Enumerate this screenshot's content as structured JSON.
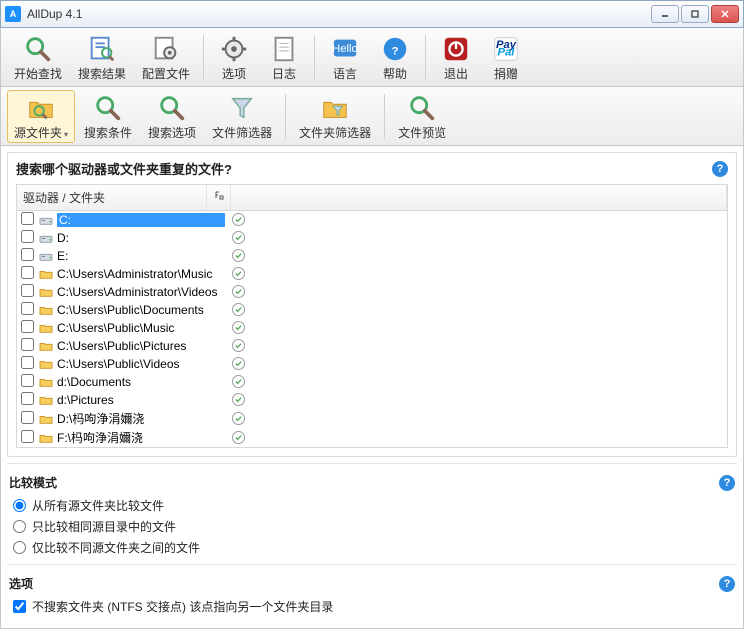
{
  "window": {
    "title": "AllDup 4.1"
  },
  "main_toolbar": [
    {
      "id": "start-search",
      "label": "开始查找",
      "icon": "magnifier"
    },
    {
      "id": "search-result",
      "label": "搜索结果",
      "icon": "result"
    },
    {
      "id": "config-file",
      "label": "配置文件",
      "icon": "gear-page"
    },
    {
      "sep": true
    },
    {
      "id": "options",
      "label": "选项",
      "icon": "gear"
    },
    {
      "id": "log",
      "label": "日志",
      "icon": "page"
    },
    {
      "sep": true
    },
    {
      "id": "language",
      "label": "语言",
      "icon": "hello"
    },
    {
      "id": "help",
      "label": "帮助",
      "icon": "help"
    },
    {
      "sep": true
    },
    {
      "id": "exit",
      "label": "退出",
      "icon": "power"
    },
    {
      "id": "donate",
      "label": "捐赠",
      "icon": "paypal"
    }
  ],
  "tab_toolbar": [
    {
      "id": "source-folders",
      "label": "源文件夹",
      "icon": "folder-search",
      "active": true,
      "dropdown": true
    },
    {
      "id": "search-criteria",
      "label": "搜索条件",
      "icon": "magnifier"
    },
    {
      "id": "search-options",
      "label": "搜索选项",
      "icon": "magnifier"
    },
    {
      "id": "file-filter",
      "label": "文件筛选器",
      "icon": "funnel"
    },
    {
      "sep": true
    },
    {
      "id": "folder-filter",
      "label": "文件夹筛选器",
      "icon": "folder-funnel"
    },
    {
      "sep": true
    },
    {
      "id": "file-preview",
      "label": "文件预览",
      "icon": "magnifier"
    }
  ],
  "source_panel": {
    "title": "搜索哪个驱动器或文件夹重复的文件?",
    "header_main": "驱动器 / 文件夹",
    "rows": [
      {
        "path": "C:",
        "type": "drive",
        "selected": true
      },
      {
        "path": "D:",
        "type": "drive"
      },
      {
        "path": "E:",
        "type": "drive"
      },
      {
        "path": "C:\\Users\\Administrator\\Music",
        "type": "folder"
      },
      {
        "path": "C:\\Users\\Administrator\\Videos",
        "type": "folder"
      },
      {
        "path": "C:\\Users\\Public\\Documents",
        "type": "folder"
      },
      {
        "path": "C:\\Users\\Public\\Music",
        "type": "folder"
      },
      {
        "path": "C:\\Users\\Public\\Pictures",
        "type": "folder"
      },
      {
        "path": "C:\\Users\\Public\\Videos",
        "type": "folder"
      },
      {
        "path": "d:\\Documents",
        "type": "folder"
      },
      {
        "path": "d:\\Pictures",
        "type": "folder"
      },
      {
        "path": "D:\\杩呴浄涓嬭浇",
        "type": "folder"
      },
      {
        "path": "F:\\杩呴浄涓嬭浇",
        "type": "folder"
      }
    ]
  },
  "compare": {
    "title": "比较模式",
    "options": [
      {
        "label": "从所有源文件夹比较文件",
        "checked": true
      },
      {
        "label": "只比较相同源目录中的文件",
        "checked": false
      },
      {
        "label": "仅比较不同源文件夹之间的文件",
        "checked": false
      }
    ]
  },
  "options_panel": {
    "title": "选项",
    "items": [
      {
        "label": "不搜索文件夹 (NTFS 交接点) 该点指向另一个文件夹目录",
        "checked": true
      }
    ]
  },
  "watermark": ""
}
